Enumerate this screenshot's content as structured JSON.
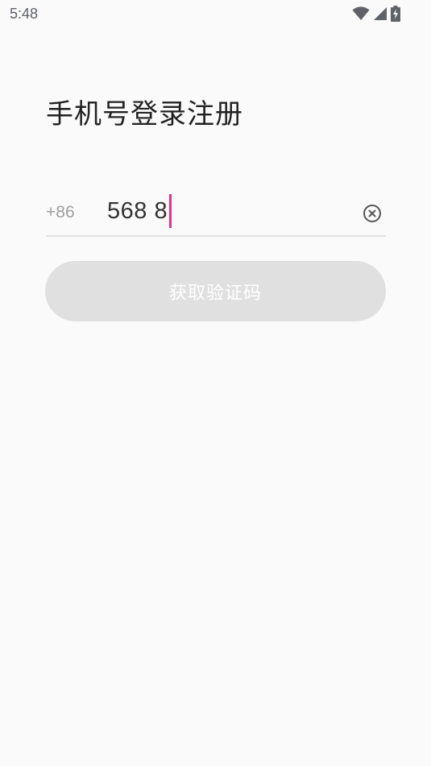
{
  "status_bar": {
    "time": "5:48",
    "icons": [
      "wifi-icon",
      "cellular-signal-icon",
      "battery-charging-icon"
    ]
  },
  "page": {
    "title": "手机号登录注册"
  },
  "phone_field": {
    "country_code": "+86",
    "value": "568 8"
  },
  "actions": {
    "get_code_label": "获取验证码"
  },
  "colors": {
    "background": "#fafafa",
    "cursor": "#e0338a",
    "button_disabled": "#e0e0e0"
  }
}
